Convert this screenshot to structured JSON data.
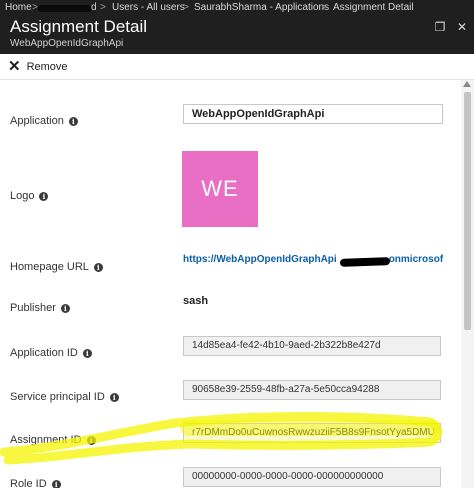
{
  "breadcrumb": {
    "items": [
      "Home",
      "d",
      "Users - All users",
      "SaurabhSharma - Applications",
      "Assignment Detail"
    ],
    "separator": ">"
  },
  "header": {
    "title": "Assignment Detail",
    "subtitle": "WebAppOpenIdGraphApi"
  },
  "window_controls": {
    "restore_icon": "restore-icon",
    "close_icon": "close-icon",
    "restore_glyph": "❐",
    "close_glyph": "✕"
  },
  "toolbar": {
    "remove_label": "Remove",
    "remove_glyph": "✕"
  },
  "details": {
    "application_label": "Application",
    "application_value": "WebAppOpenIdGraphApi",
    "logo_label": "Logo",
    "logo_text": "WE",
    "homepage_label": "Homepage URL",
    "homepage_value": "https://WebAppOpenIdGraphApi",
    "homepage_value_tail": "onmicrosof",
    "publisher_label": "Publisher",
    "publisher_value": "sash",
    "application_id_label": "Application ID",
    "application_id_value": "14d85ea4-fe42-4b10-9aed-2b322b8e427d",
    "service_principal_label": "Service principal ID",
    "service_principal_value": "90658e39-2559-48fb-a27a-5e50cca94288",
    "assignment_id_label": "Assignment ID",
    "assignment_id_value": "r7rDMmDo0uCuwnosRwwzuziiF5B8s9FnsotYya5DMU",
    "role_id_label": "Role ID",
    "role_id_value": "00000000-0000-0000-0000-000000000000"
  },
  "info_glyph": "i",
  "colors": {
    "header_bg": "#1f1f1f",
    "logo_bg": "#e86fc4",
    "link": "#0b5ea8",
    "highlight": "#f4f400"
  }
}
